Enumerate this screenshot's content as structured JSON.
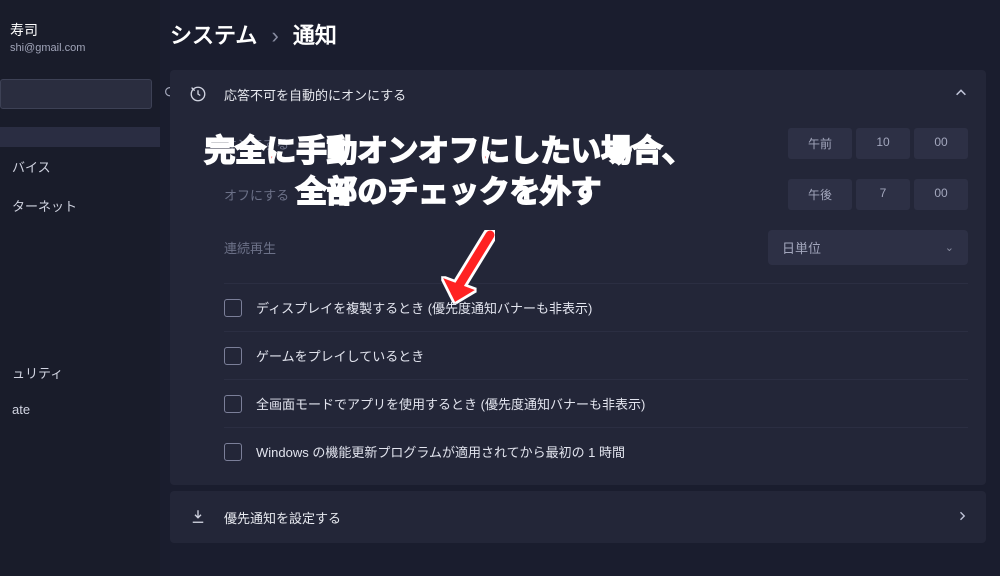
{
  "user": {
    "name": "寿司",
    "email": "shi@gmail.com"
  },
  "sidebar": {
    "items": [
      {
        "label": ""
      },
      {
        "label": "バイス"
      },
      {
        "label": "ターネット"
      },
      {
        "label": ""
      },
      {
        "label": ""
      },
      {
        "label": ""
      },
      {
        "label": ""
      },
      {
        "label": "ュリティ"
      },
      {
        "label": "ate"
      }
    ]
  },
  "breadcrumb": {
    "parent": "システム",
    "current": "通知"
  },
  "card_auto_dnd": {
    "title": "応答不可を自動的にオンにする",
    "rows": {
      "on": {
        "label": "オンにする",
        "ampm": "午前",
        "hour": "10",
        "min": "00"
      },
      "off": {
        "label": "オフにする",
        "ampm": "午後",
        "hour": "7",
        "min": "00"
      },
      "repeat": {
        "label": "連続再生",
        "value": "日単位"
      }
    },
    "checks": [
      "ディスプレイを複製するとき (優先度通知バナーも非表示)",
      "ゲームをプレイしているとき",
      "全画面モードでアプリを使用するとき (優先度通知バナーも非表示)",
      "Windows の機能更新プログラムが適用されてから最初の 1 時間"
    ]
  },
  "card_priority": {
    "title": "優先通知を設定する"
  },
  "annotation": {
    "line1": "完全に手動オンオフにしたい場合、",
    "line2": "全部のチェックを外す"
  }
}
